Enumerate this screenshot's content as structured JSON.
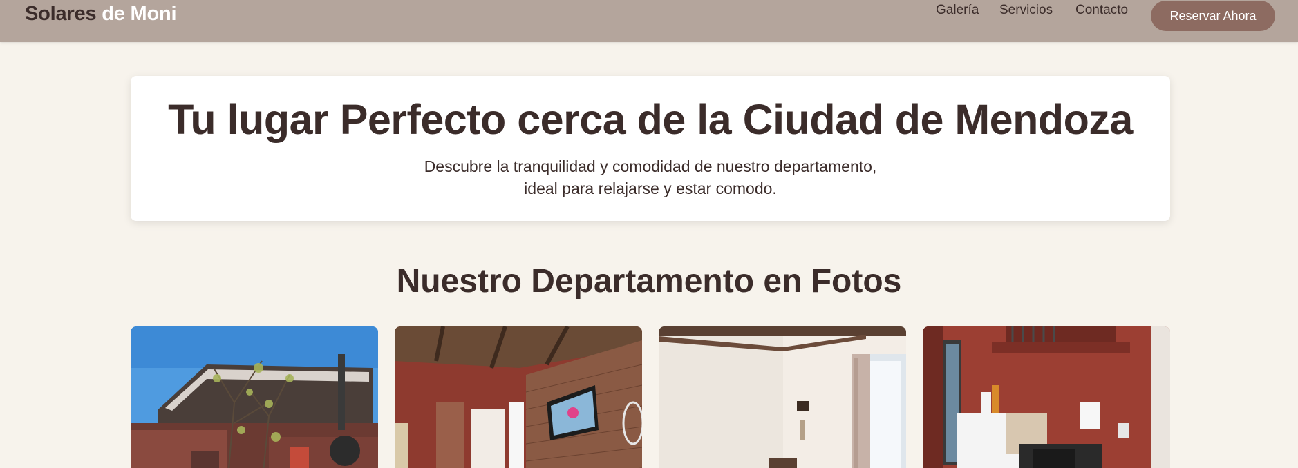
{
  "header": {
    "brand_part1": "Solares",
    "brand_part2": "de Moni",
    "nav": [
      {
        "label": "Galería"
      },
      {
        "label": "Servicios"
      },
      {
        "label": "Contacto"
      }
    ],
    "cta_label": "Reservar Ahora"
  },
  "hero": {
    "title": "Tu lugar Perfecto cerca de la Ciudad de Mendoza",
    "subtitle_line1": "Descubre la tranquilidad y comodidad de nuestro departamento,",
    "subtitle_line2": "ideal para relajarse y estar comodo."
  },
  "gallery": {
    "title": "Nuestro Departamento en Fotos",
    "photos": [
      {
        "subject": "exterior-patio-photo"
      },
      {
        "subject": "living-room-tv-photo"
      },
      {
        "subject": "bedroom-window-photo"
      },
      {
        "subject": "kitchen-fridge-photo"
      }
    ]
  },
  "colors": {
    "header_bg": "#b4a59c",
    "page_bg": "#f7f3ec",
    "text_dark": "#3b2c2a",
    "cta_bg": "#8d6b61"
  }
}
